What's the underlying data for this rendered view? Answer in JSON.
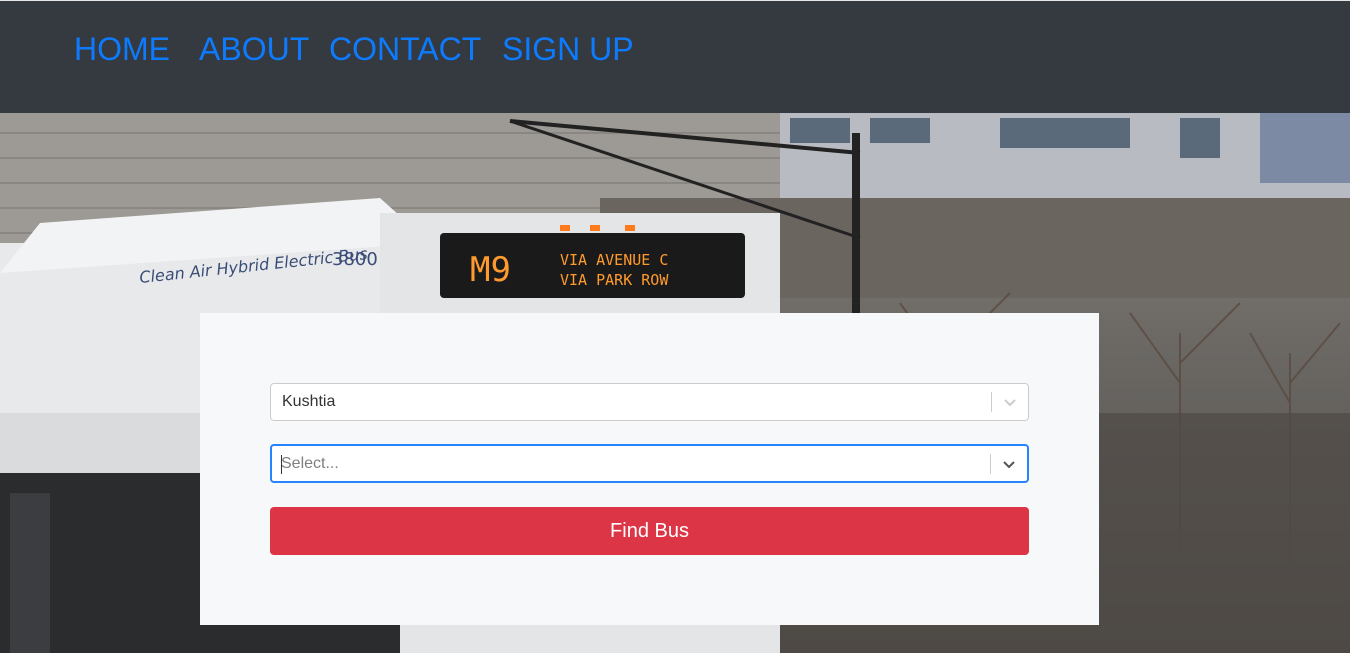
{
  "nav": {
    "items": [
      {
        "label": "HOME"
      },
      {
        "label": "ABOUT"
      },
      {
        "label": "CONTACT"
      },
      {
        "label": "SIGN UP"
      }
    ],
    "link_color": "#0d7bff",
    "bg_color": "#343a40"
  },
  "hero": {
    "bus_front_sign": {
      "route": "M9",
      "line1": "VIA AVENUE C",
      "line2": "VIA PARK ROW"
    },
    "bus_side_text": "Clean Air Hybrid Electric Bus",
    "bus_number": "3800"
  },
  "search_form": {
    "from_select": {
      "value": "Kushtia",
      "icon": "chevron-down-icon"
    },
    "to_select": {
      "placeholder": "Select...",
      "icon": "chevron-down-icon"
    },
    "find_button_label": "Find Bus",
    "button_color": "#dc3545",
    "focus_color": "#2684ff"
  }
}
